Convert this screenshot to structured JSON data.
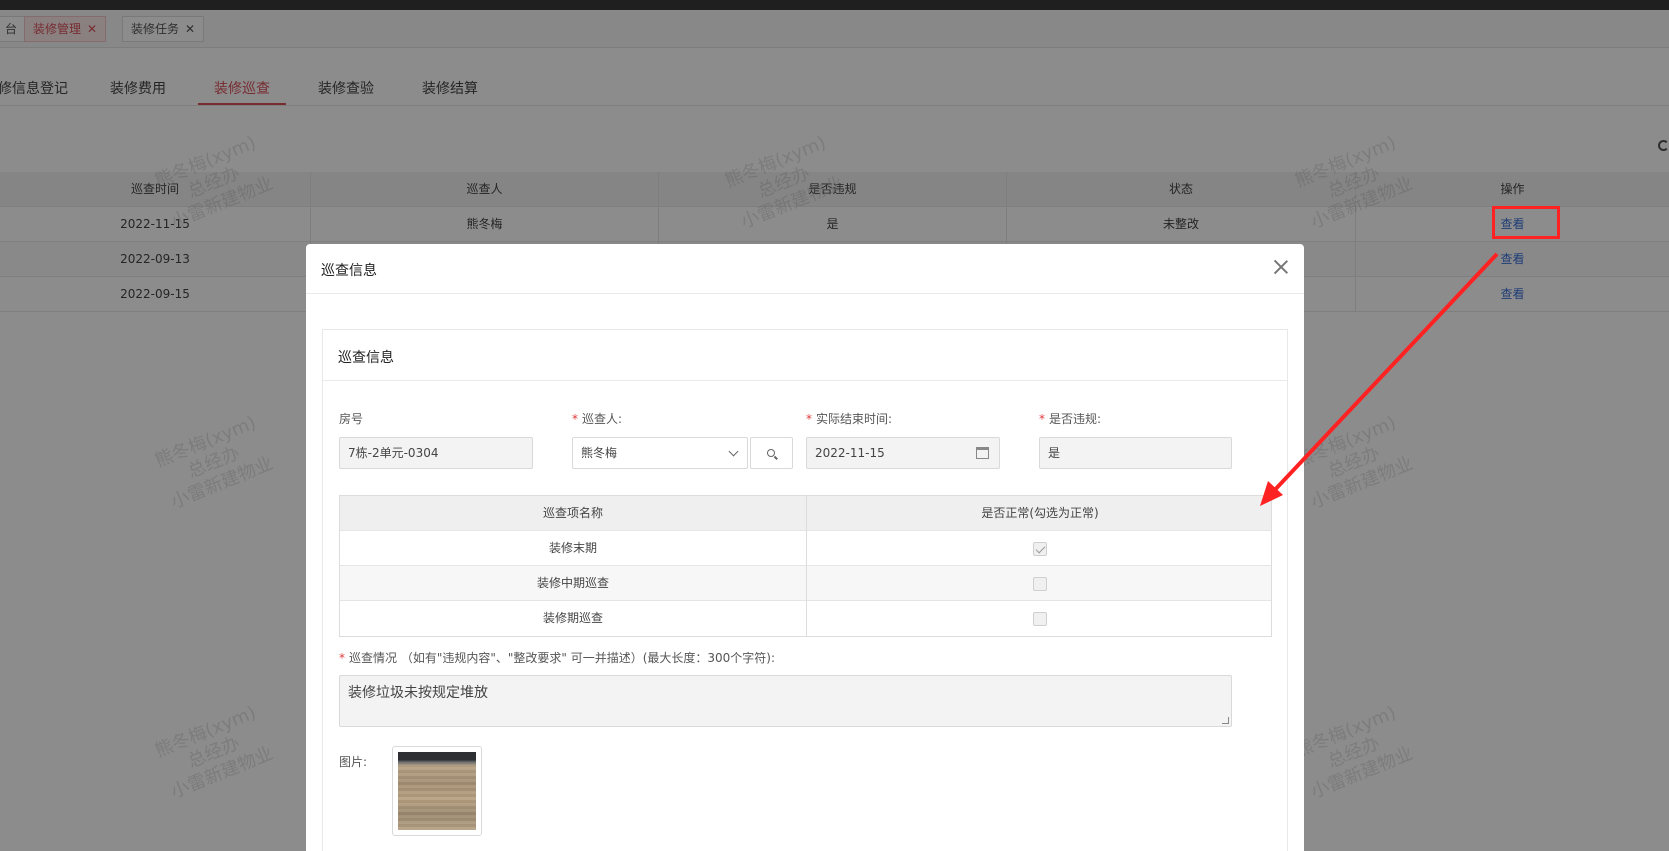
{
  "tags": [
    {
      "label": "台",
      "active": false
    },
    {
      "label": "装修管理",
      "active": true
    },
    {
      "label": "装修任务",
      "active": false
    }
  ],
  "subtabs": [
    "修信息登记",
    "装修费用",
    "装修巡查",
    "装修查验",
    "装修结算"
  ],
  "grid": {
    "headers": [
      "巡查时间",
      "巡查人",
      "是否违规",
      "状态",
      "操作"
    ],
    "rows": [
      {
        "date": "2022-11-15",
        "person": "熊冬梅",
        "violation": "是",
        "status": "未整改",
        "action": "查看"
      },
      {
        "date": "2022-09-13",
        "person": "",
        "violation": "",
        "status": "",
        "action": "查看"
      },
      {
        "date": "2022-09-15",
        "person": "",
        "violation": "",
        "status": "",
        "action": "查看"
      }
    ]
  },
  "watermark": {
    "line1": "熊冬梅(xym)",
    "line2": "总经办",
    "line3": "小雷新建物业"
  },
  "modal": {
    "title": "巡查信息",
    "panel_title": "巡查信息",
    "fields": {
      "room": {
        "label": "房号",
        "value": "7栋-2单元-0304"
      },
      "inspector": {
        "label": "巡查人:",
        "value": "熊冬梅"
      },
      "end_time": {
        "label": "实际结束时间:",
        "value": "2022-11-15"
      },
      "violation": {
        "label": "是否违规:",
        "value": "是"
      }
    },
    "items_table": {
      "headers": [
        "巡查项名称",
        "是否正常(勾选为正常)"
      ],
      "rows": [
        {
          "name": "装修末期",
          "checked": true
        },
        {
          "name": "装修中期巡查",
          "checked": false
        },
        {
          "name": "装修期巡查",
          "checked": false
        }
      ]
    },
    "situation": {
      "label": "巡查情况 （如有\"违规内容\"、\"整改要求\" 可一并描述）(最大长度：300个字符):",
      "value": "装修垃圾未按规定堆放"
    },
    "image_label": "图片:"
  },
  "colors": {
    "accent": "#d9505a",
    "link": "#3a6fd8",
    "annotation": "#ff2222"
  }
}
